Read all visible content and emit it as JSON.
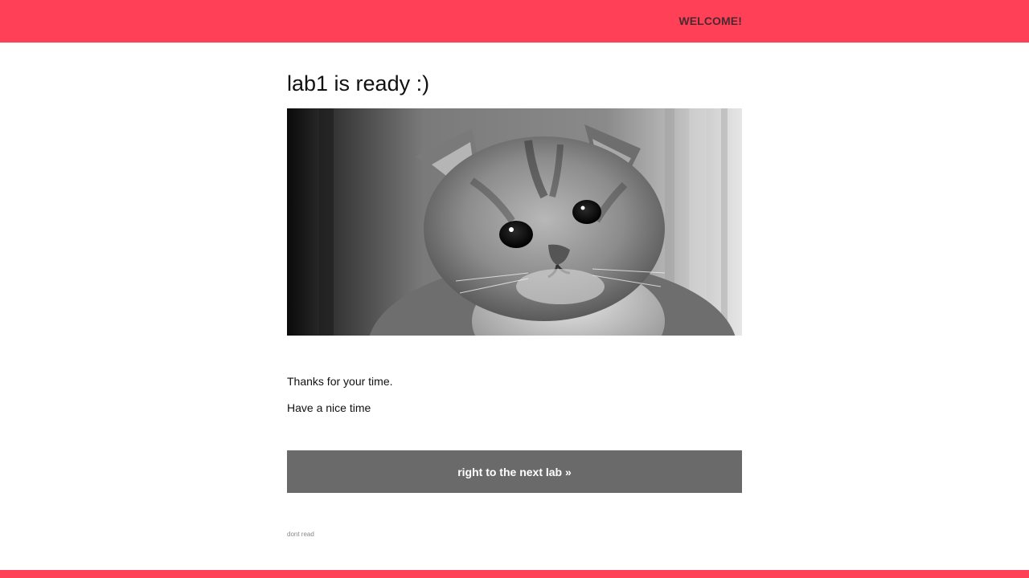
{
  "header": {
    "welcome": "WELCOME!"
  },
  "main": {
    "title": "lab1 is ready :)",
    "image_alt": "grayscale kitten photo",
    "message_1": "Thanks for your time.",
    "message_2": "Have a nice time",
    "next_button": "right to the next lab »",
    "small_note": "dont read"
  },
  "colors": {
    "accent": "#ff4057",
    "button_bg": "#6a6a6a",
    "button_text": "#ffffff"
  }
}
